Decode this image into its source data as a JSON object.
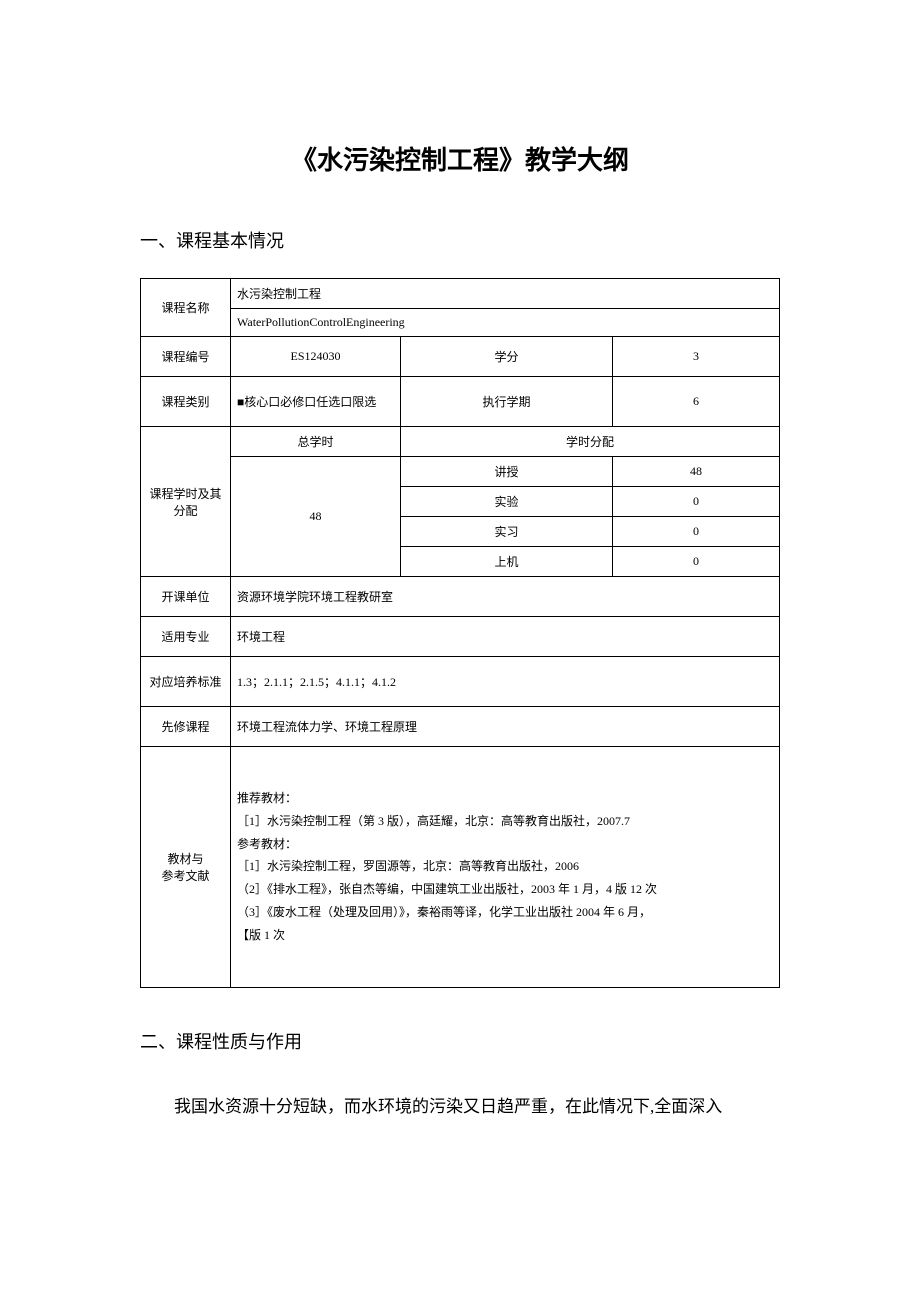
{
  "title": "《水污染控制工程》教学大纲",
  "section1": "一、课程基本情况",
  "section2": "二、课程性质与作用",
  "labels": {
    "courseName": "课程名称",
    "courseCode": "课程编号",
    "credits": "学分",
    "courseType": "课程类别",
    "semester": "执行学期",
    "hoursAlloc": "课程学时及其分配",
    "totalHours": "总学时",
    "hoursDist": "学时分配",
    "lecture": "讲授",
    "experiment": "实验",
    "practice": "实习",
    "computer": "上机",
    "dept": "开课单位",
    "major": "适用专业",
    "standard": "对应培养标准",
    "prereq": "先修课程",
    "references": "教材与",
    "references2": "参考文献"
  },
  "values": {
    "courseNameCn": "水污染控制工程",
    "courseNameEn": "WaterPollutionControlEngineering",
    "courseCode": "ES124030",
    "credits": "3",
    "courseType": "■核心口必修口任选口限选",
    "semester": "6",
    "totalHours": "48",
    "lecture": "48",
    "experiment": "0",
    "practice": "0",
    "computer": "0",
    "dept": "资源环境学院环境工程教研室",
    "major": "环境工程",
    "standard": "1.3；2.1.1；2.1.5；4.1.1；4.1.2",
    "prereq": "环境工程流体力学、环境工程原理",
    "refIntro": "推荐教材：",
    "ref1": "［1］水污染控制工程（第 3 版），高廷耀，北京：高等教育出版社，2007.7",
    "refIntro2": "参考教材：",
    "ref2": "［1］水污染控制工程，罗固源等，北京：高等教育出版社，2006",
    "ref3": "（2］《排水工程》，张自杰等编，中国建筑工业出版社，2003 年 1 月，4 版 12 次",
    "ref4": "（3］《废水工程（处理及回用）》，秦裕雨等译，化学工业出版社 2004 年 6 月，",
    "ref5": "【版 1 次"
  },
  "bodyPara": "我国水资源十分短缺，而水环境的污染又日趋严重，在此情况下,全面深入"
}
